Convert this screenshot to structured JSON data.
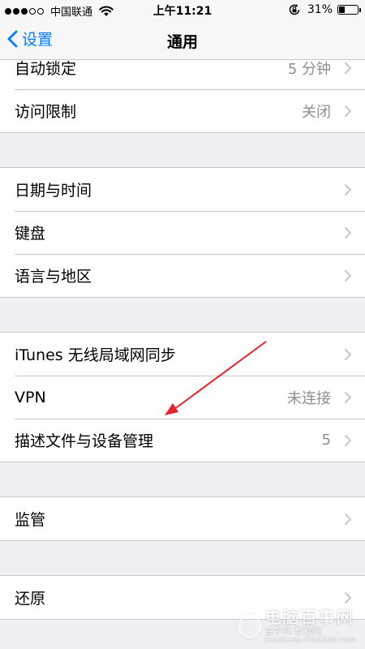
{
  "status_bar": {
    "carrier": "中国联通",
    "time": "上午11:21",
    "battery_percent": "31%",
    "battery_level": 0.31,
    "signal_bars_filled": 3,
    "signal_bars_total": 5
  },
  "nav": {
    "back_label": "设置",
    "title": "通用"
  },
  "rows": {
    "auto_lock": {
      "label": "自动锁定",
      "value": "5 分钟"
    },
    "restrictions": {
      "label": "访问限制",
      "value": "关闭"
    },
    "date_time": {
      "label": "日期与时间"
    },
    "keyboard": {
      "label": "键盘"
    },
    "language_region": {
      "label": "语言与地区"
    },
    "itunes_wifi_sync": {
      "label": "iTunes 无线局域网同步"
    },
    "vpn": {
      "label": "VPN",
      "value": "未连接"
    },
    "profiles": {
      "label": "描述文件与设备管理",
      "value": "5"
    },
    "supervision": {
      "label": "监管"
    },
    "reset": {
      "label": "还原"
    }
  },
  "watermark": {
    "title": "电脑百事网",
    "subtitle": "查字典 教程网",
    "url": "jiaocheng.chazidian.com"
  },
  "colors": {
    "accent": "#007aff",
    "background": "#efeff4",
    "separator": "#c8c7cc",
    "secondary_text": "#8e8e93",
    "annotation_arrow": "#e8202a"
  },
  "icons": {
    "back": "chevron-left-icon",
    "disclosure": "chevron-right-icon",
    "wifi": "wifi-icon",
    "rotation_lock": "rotation-lock-icon",
    "battery": "battery-icon"
  }
}
